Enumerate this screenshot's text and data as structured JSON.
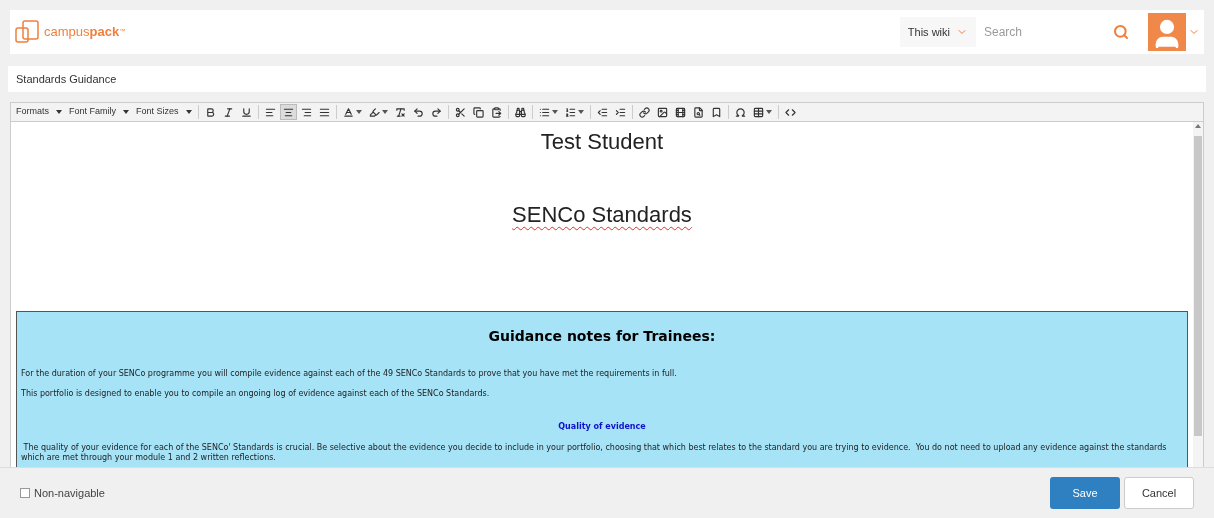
{
  "header": {
    "logo_text": "campus",
    "logo_bold": "pack",
    "logo_tm": "™",
    "scope": "This wiki",
    "search": {
      "placeholder": "Search"
    }
  },
  "page_title": {
    "value": "Standards Guidance"
  },
  "toolbar": {
    "dropdowns": [
      "Formats",
      "Font Family",
      "Font Sizes"
    ],
    "buttons": [
      {
        "kind": "bold",
        "selected": false
      },
      {
        "kind": "italic",
        "selected": false
      },
      {
        "kind": "underline",
        "selected": false
      },
      {
        "kind": "sep"
      },
      {
        "kind": "align-left",
        "selected": false
      },
      {
        "kind": "align-center",
        "selected": true
      },
      {
        "kind": "align-right",
        "selected": false
      },
      {
        "kind": "justify",
        "selected": false
      },
      {
        "kind": "sep"
      },
      {
        "kind": "text-color",
        "selected": false
      },
      {
        "kind": "bg-color",
        "selected": false
      },
      {
        "kind": "clear-format",
        "selected": false
      },
      {
        "kind": "undo",
        "selected": false
      },
      {
        "kind": "redo",
        "selected": false
      },
      {
        "kind": "sep"
      },
      {
        "kind": "cut",
        "selected": false
      },
      {
        "kind": "copy",
        "selected": false
      },
      {
        "kind": "paste",
        "selected": false
      },
      {
        "kind": "sep"
      },
      {
        "kind": "find",
        "selected": false
      },
      {
        "kind": "sep"
      },
      {
        "kind": "bullets",
        "selected": false
      },
      {
        "kind": "numbers",
        "selected": false
      },
      {
        "kind": "sep"
      },
      {
        "kind": "outdent",
        "selected": false
      },
      {
        "kind": "indent",
        "selected": false
      },
      {
        "kind": "sep"
      },
      {
        "kind": "link",
        "selected": false
      },
      {
        "kind": "image",
        "selected": false
      },
      {
        "kind": "video",
        "selected": false
      },
      {
        "kind": "preview",
        "selected": false
      },
      {
        "kind": "bookmark",
        "selected": false
      },
      {
        "kind": "sep"
      },
      {
        "kind": "symbol",
        "selected": false
      },
      {
        "kind": "table",
        "selected": false
      },
      {
        "kind": "sep"
      },
      {
        "kind": "code",
        "selected": false
      }
    ]
  },
  "document": {
    "title": "Test Student",
    "subtitle": "SENCo Standards",
    "box": {
      "heading": "Guidance notes for Trainees:",
      "blocks": [
        {
          "kind": "para",
          "text": "For the duration of your SENCo programme you will compile evidence against each of the 49 SENCo Standards to prove that you have met the requirements in full."
        },
        {
          "kind": "para",
          "text": "This portfolio is designed to enable you to compile an ongoing log of evidence against each of the SENCo Standards."
        },
        {
          "kind": "heading",
          "text": "Quality of evidence"
        },
        {
          "kind": "para",
          "text": " The quality of your evidence for each of the SENCo' Standards is crucial. Be selective about the evidence you decide to include in your portfolio, choosing that which best relates to the standard you are trying to evidence.  You do not need to upload any evidence against the standards which are met through your module 1 and 2 written reflections."
        }
      ]
    }
  },
  "footer": {
    "non_navigable": {
      "label": "Non-navigable",
      "checked": false
    },
    "buttons": [
      "Save",
      "Cancel"
    ]
  }
}
